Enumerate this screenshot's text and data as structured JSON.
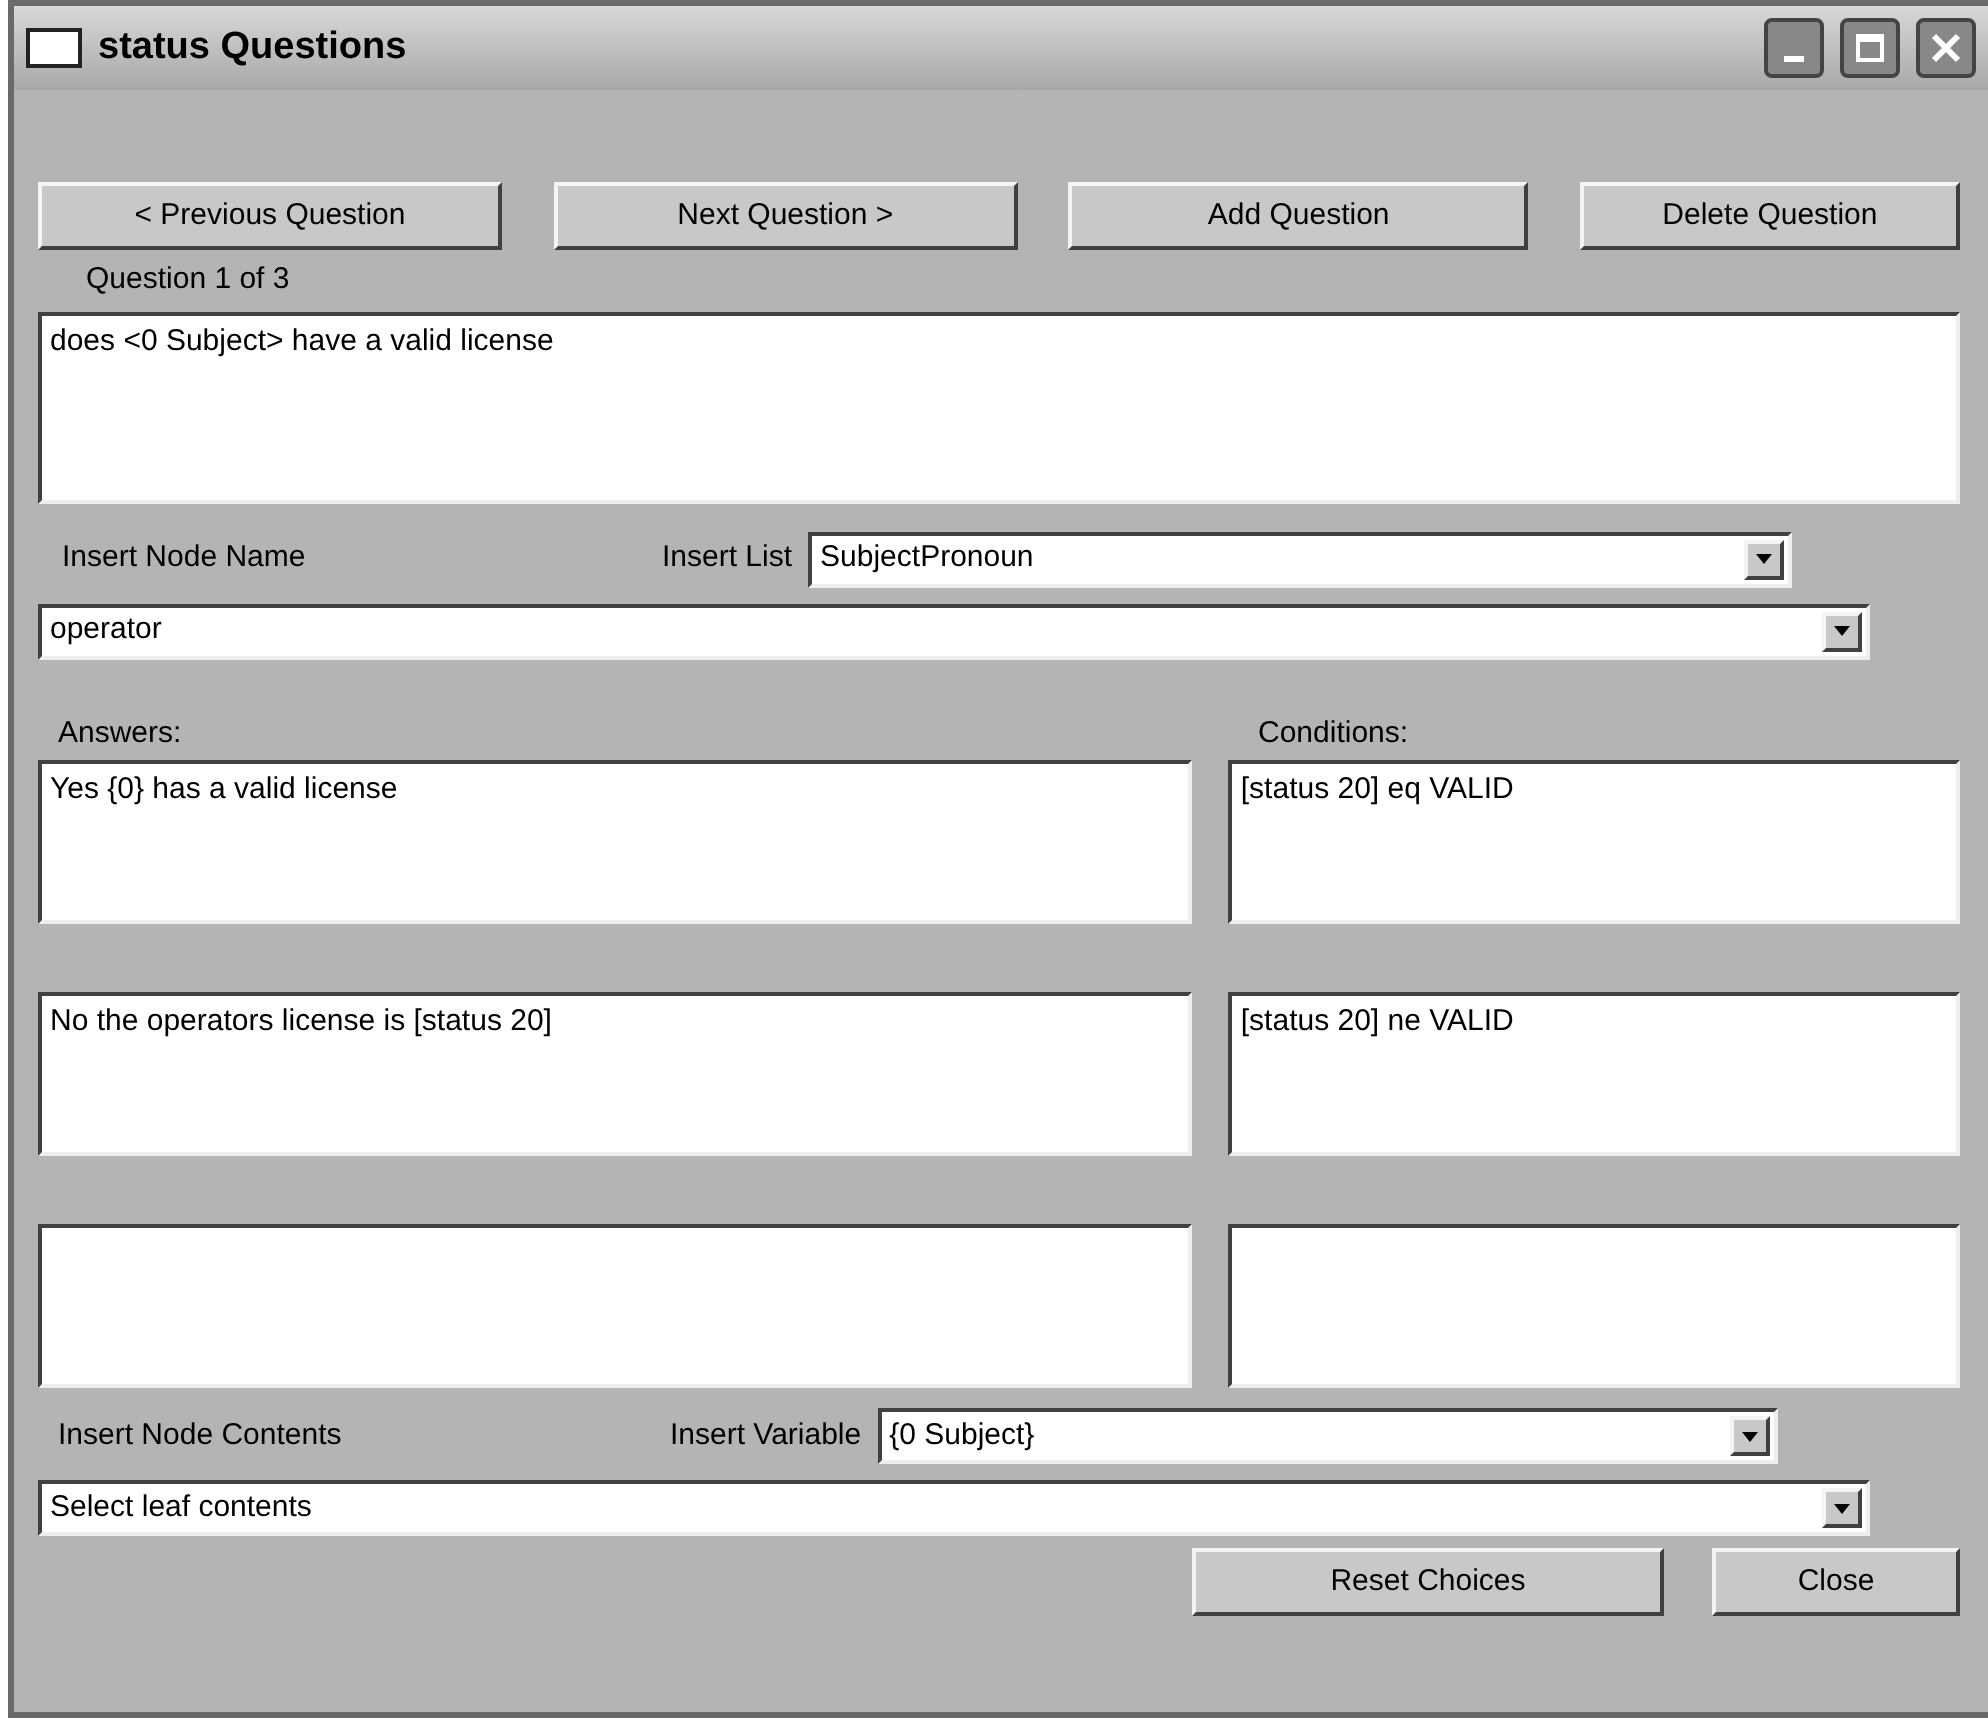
{
  "window": {
    "title": "status Questions"
  },
  "top_buttons": [
    "< Previous Question",
    "Next Question >",
    "Add Question",
    "Delete Question"
  ],
  "question_counter": "Question 1 of 3",
  "question_text": "does <0 Subject> have a valid license",
  "insert_node_name_label": "Insert Node Name",
  "insert_list": {
    "label": "Insert List",
    "value": "SubjectPronoun"
  },
  "node_name": {
    "value": "operator"
  },
  "answers_label": "Answers:",
  "conditions_label": "Conditions:",
  "rows": [
    {
      "answer": "Yes {0} has a valid license",
      "condition": "[status 20] eq VALID"
    },
    {
      "answer": "No the operators license is [status 20]",
      "condition": "[status 20]  ne VALID"
    },
    {}
  ],
  "insert_node_contents_label": "Insert Node Contents",
  "insert_variable": {
    "label": "Insert Variable",
    "value": "{0 Subject}"
  },
  "leaf_contents": {
    "value": "Select leaf contents"
  },
  "bottom_buttons": [
    "Reset Choices",
    "Close"
  ]
}
